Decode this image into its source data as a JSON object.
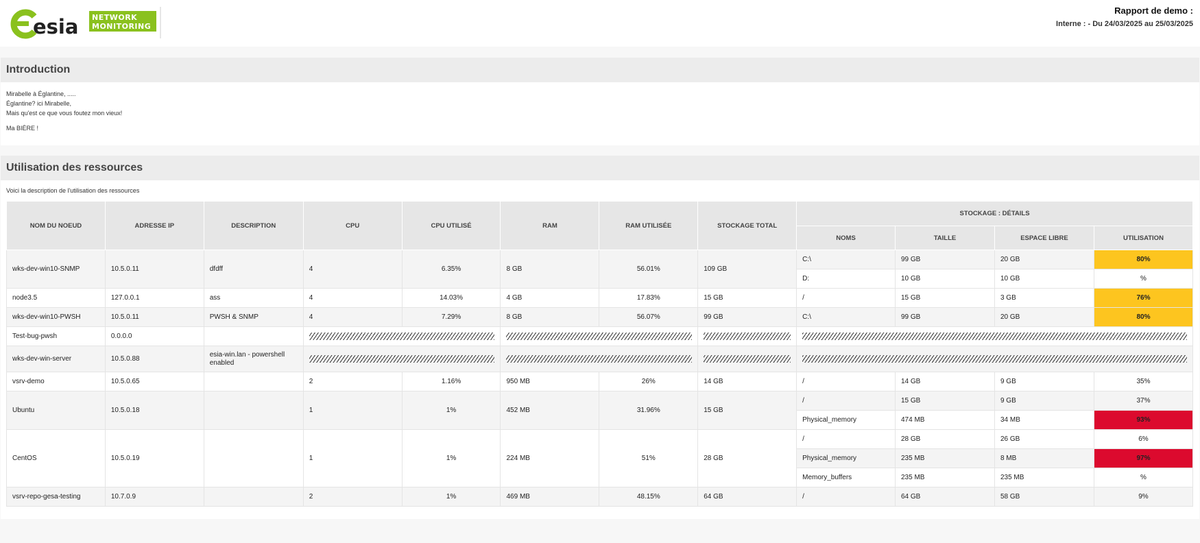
{
  "logo": {
    "brand_text": "esia",
    "badge_line1": "NETWORK",
    "badge_line2": "MONITORING",
    "green": "#8ac11e",
    "dark": "#222222"
  },
  "report": {
    "title": "Rapport de demo :",
    "period": "Interne : - Du 24/03/2025 au 25/03/2025"
  },
  "intro": {
    "title": "Introduction",
    "lines": [
      "Mirabelle à Églantine, .....",
      "Églantine? ici Mirabelle,",
      "Mais qu'est ce que vous foutez mon vieux!",
      "Ma BIÈRE !"
    ]
  },
  "resources": {
    "title": "Utilisation des ressources",
    "description": "Voici la description de l'utilisation des ressources",
    "headers": {
      "node": "NOM DU NOEUD",
      "ip": "ADRESSE IP",
      "desc": "DESCRIPTION",
      "cpu": "CPU",
      "cpu_used": "CPU UTILISÉ",
      "ram": "RAM",
      "ram_used": "RAM UTILISÉE",
      "storage_total": "STOCKAGE TOTAL",
      "storage_details": "STOCKAGE : DÉTAILS",
      "names": "NOMS",
      "size": "TAILLE",
      "free": "ESPACE LIBRE",
      "usage": "UTILISATION"
    },
    "colors": {
      "warning": "#fdc51f",
      "critical": "#dc0a2e",
      "header_bg": "#e6e6e6"
    },
    "rows": [
      {
        "node": "wks-dev-win10-SNMP",
        "ip": "10.5.0.11",
        "desc": "dfdff",
        "cpu": "4",
        "cpu_used": "6.35%",
        "ram": "8 GB",
        "ram_used": "56.01%",
        "storage_total": "109 GB",
        "storage": [
          {
            "name": "C:\\",
            "size": "99 GB",
            "free": "20 GB",
            "usage": "80%",
            "level": "warning"
          },
          {
            "name": "D:",
            "size": "10 GB",
            "free": "10 GB",
            "usage": "%",
            "level": ""
          }
        ]
      },
      {
        "node": "node3.5",
        "ip": "127.0.0.1",
        "desc": "ass",
        "cpu": "4",
        "cpu_used": "14.03%",
        "ram": "4 GB",
        "ram_used": "17.83%",
        "storage_total": "15 GB",
        "storage": [
          {
            "name": "/",
            "size": "15 GB",
            "free": "3 GB",
            "usage": "76%",
            "level": "warning"
          }
        ]
      },
      {
        "node": "wks-dev-win10-PWSH",
        "ip": "10.5.0.11",
        "desc": "PWSH & SNMP",
        "cpu": "4",
        "cpu_used": "7.29%",
        "ram": "8 GB",
        "ram_used": "56.07%",
        "storage_total": "99 GB",
        "storage": [
          {
            "name": "C:\\",
            "size": "99 GB",
            "free": "20 GB",
            "usage": "80%",
            "level": "warning"
          }
        ]
      },
      {
        "node": "Test-bug-pwsh",
        "ip": "0.0.0.0",
        "desc": "",
        "no_data": true
      },
      {
        "node": "wks-dev-win-server",
        "ip": "10.5.0.88",
        "desc": "esia-win.lan - powershell enabled",
        "no_data": true
      },
      {
        "node": "vsrv-demo",
        "ip": "10.5.0.65",
        "desc": "",
        "cpu": "2",
        "cpu_used": "1.16%",
        "ram": "950 MB",
        "ram_used": "26%",
        "storage_total": "14 GB",
        "storage": [
          {
            "name": "/",
            "size": "14 GB",
            "free": "9 GB",
            "usage": "35%",
            "level": ""
          }
        ]
      },
      {
        "node": "Ubuntu",
        "ip": "10.5.0.18",
        "desc": "",
        "cpu": "1",
        "cpu_used": "1%",
        "ram": "452 MB",
        "ram_used": "31.96%",
        "storage_total": "15 GB",
        "storage": [
          {
            "name": "/",
            "size": "15 GB",
            "free": "9 GB",
            "usage": "37%",
            "level": ""
          },
          {
            "name": "Physical_memory",
            "size": "474 MB",
            "free": "34 MB",
            "usage": "93%",
            "level": "critical"
          }
        ]
      },
      {
        "node": "CentOS",
        "ip": "10.5.0.19",
        "desc": "",
        "cpu": "1",
        "cpu_used": "1%",
        "ram": "224 MB",
        "ram_used": "51%",
        "storage_total": "28 GB",
        "storage": [
          {
            "name": "/",
            "size": "28 GB",
            "free": "26 GB",
            "usage": "6%",
            "level": ""
          },
          {
            "name": "Physical_memory",
            "size": "235 MB",
            "free": "8 MB",
            "usage": "97%",
            "level": "critical"
          },
          {
            "name": "Memory_buffers",
            "size": "235 MB",
            "free": "235 MB",
            "usage": "%",
            "level": ""
          }
        ]
      },
      {
        "node": "vsrv-repo-gesa-testing",
        "ip": "10.7.0.9",
        "desc": "",
        "cpu": "2",
        "cpu_used": "1%",
        "ram": "469 MB",
        "ram_used": "48.15%",
        "storage_total": "64 GB",
        "storage": [
          {
            "name": "/",
            "size": "64 GB",
            "free": "58 GB",
            "usage": "9%",
            "level": ""
          }
        ]
      }
    ]
  }
}
